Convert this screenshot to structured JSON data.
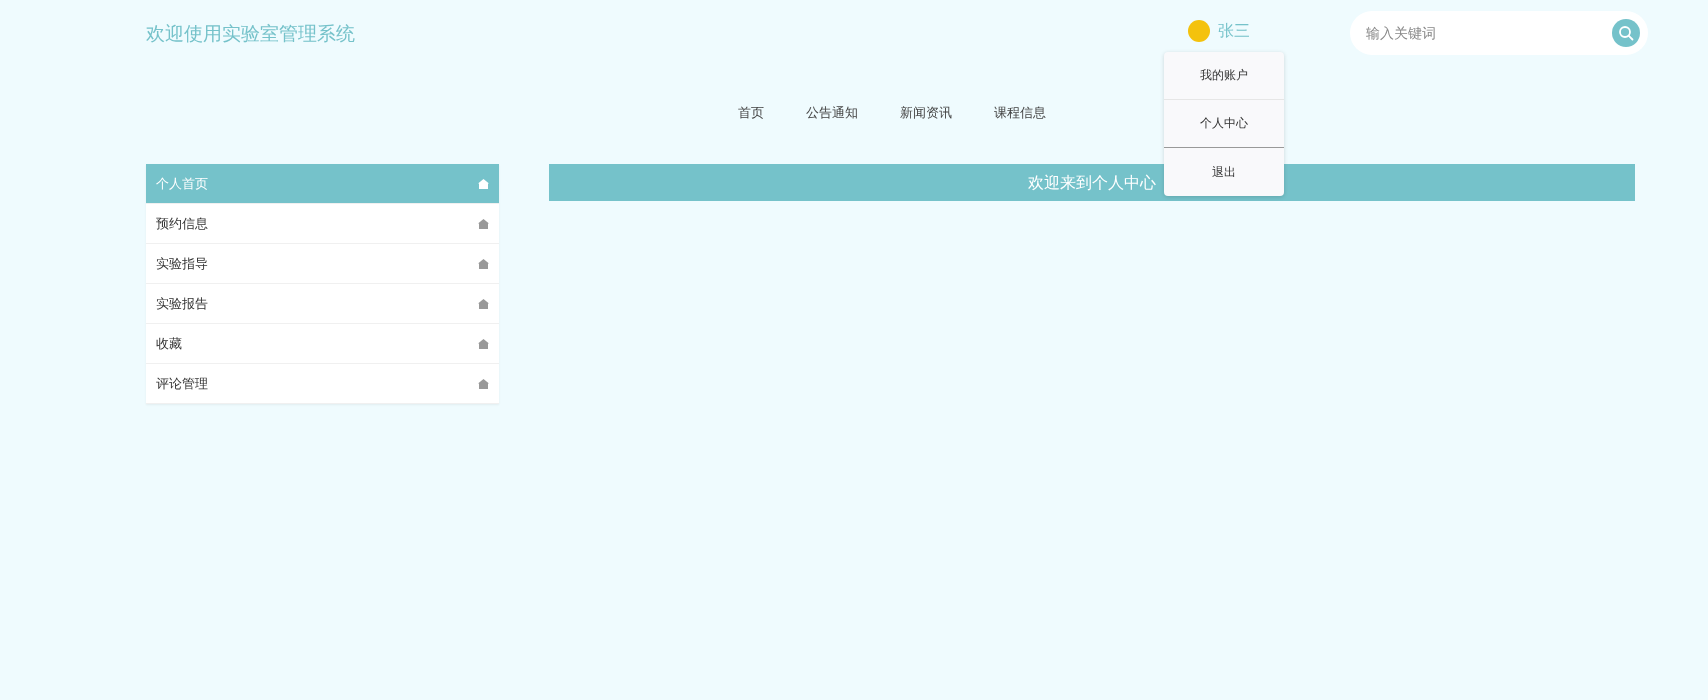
{
  "header": {
    "title": "欢迎使用实验室管理系统",
    "user": {
      "name": "张三"
    },
    "search": {
      "placeholder": "输入关键词"
    }
  },
  "user_menu": [
    "我的账户",
    "个人中心",
    "退出"
  ],
  "nav": [
    {
      "label": "首页"
    },
    {
      "label": "公告通知"
    },
    {
      "label": "新闻资讯"
    },
    {
      "label": "课程信息"
    }
  ],
  "sidebar": {
    "items": [
      {
        "label": "个人首页",
        "selected": true
      },
      {
        "label": "预约信息",
        "selected": false
      },
      {
        "label": "实验指导",
        "selected": false
      },
      {
        "label": "实验报告",
        "selected": false
      },
      {
        "label": "收藏",
        "selected": false
      },
      {
        "label": "评论管理",
        "selected": false
      }
    ]
  },
  "main": {
    "title": "欢迎来到个人中心"
  }
}
